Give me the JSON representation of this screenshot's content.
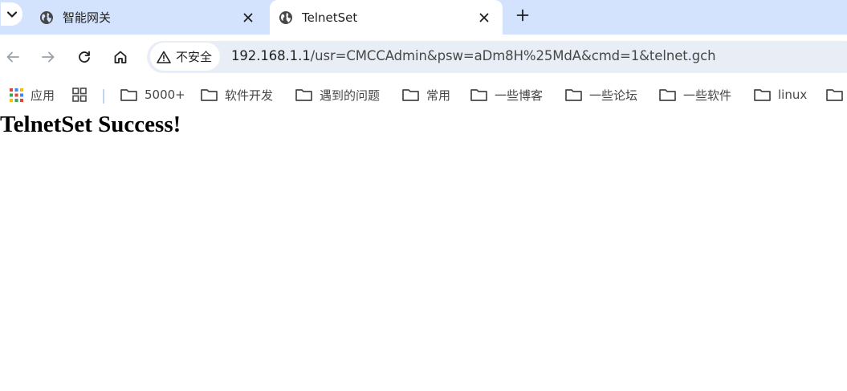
{
  "tabs": [
    {
      "title": "智能网关",
      "active": false
    },
    {
      "title": "TelnetSet",
      "active": true
    }
  ],
  "security": {
    "label": "不安全"
  },
  "address": {
    "host": "192.168.1.1",
    "path": "/usr=CMCCAdmin&psw=aDm8H%25MdA&cmd=1&telnet.gch"
  },
  "bookmarks": {
    "apps": "应用",
    "folders": [
      "5000+",
      "软件开发",
      "遇到的问题",
      "常用",
      "一些博客",
      "一些论坛",
      "一些软件",
      "linux"
    ]
  },
  "page": {
    "message": "TelnetSet Success!"
  }
}
